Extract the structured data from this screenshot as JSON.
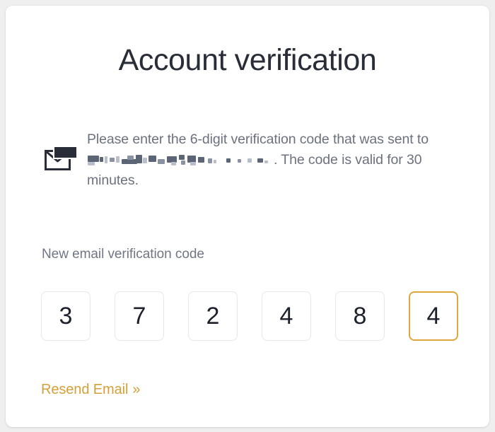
{
  "page": {
    "background_color": "#efefef",
    "card_background": "#ffffff"
  },
  "header": {
    "title": "Account verification"
  },
  "info": {
    "icon": "envelope-icon",
    "line_1": "Please enter the 6-digit verification code that was sent",
    "line_2_prefix": "to",
    "email_redacted": "████████████████",
    "line_2_suffix": ". The code is valid for 30",
    "line_3": "minutes.",
    "full_text": "Please enter the 6-digit verification code that was sent to [redacted]. The code is valid for 30 minutes."
  },
  "form": {
    "label": "New email verification code",
    "digits": [
      {
        "value": "3",
        "focused": false
      },
      {
        "value": "7",
        "focused": false
      },
      {
        "value": "2",
        "focused": false
      },
      {
        "value": "4",
        "focused": false
      },
      {
        "value": "8",
        "focused": false
      },
      {
        "value": "4",
        "focused": true
      }
    ],
    "focused_index": 5,
    "code": "372484",
    "digit_count": 6
  },
  "actions": {
    "resend_label": "Resend Email",
    "resend_chevron": "»",
    "resend_color": "#d3a03a"
  },
  "colors": {
    "accent": "#d3a03a",
    "focus_border": "#dfa73b",
    "title_text": "#282d37",
    "body_text": "#6b717e",
    "label_text": "#707683",
    "digit_text": "#1d212b",
    "box_border": "#e6e7e9"
  }
}
